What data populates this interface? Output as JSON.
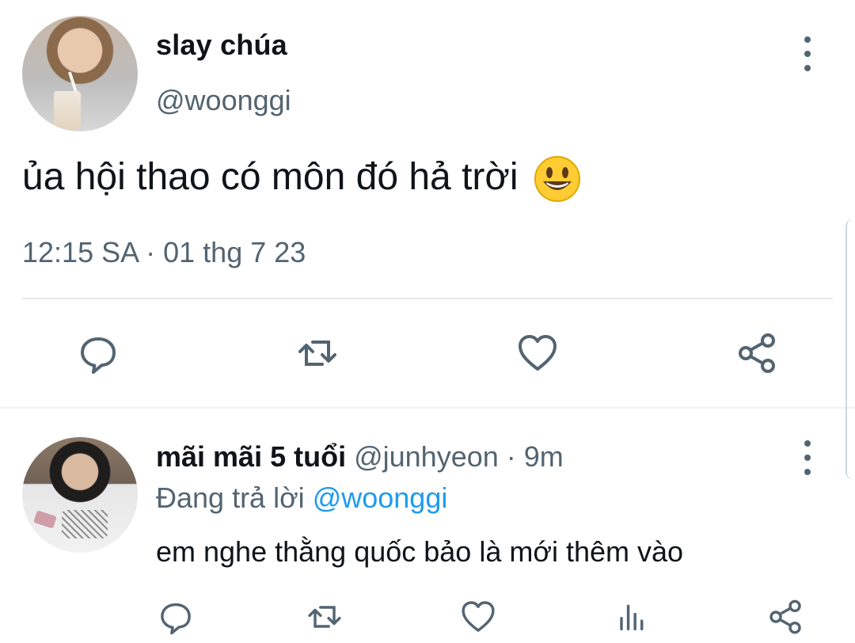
{
  "tweet": {
    "display_name": "slay chúa",
    "handle": "@woonggi",
    "text": "ủa hội thao có môn đó hả trời",
    "emoji": "grinning-face-emoji",
    "timestamp": "12:15 SA · 01 thg 7 23"
  },
  "reply": {
    "display_name": "mãi mãi 5 tuổi",
    "meta": "@junhyeon · 9m",
    "replying_prefix": "Đang trả lời",
    "replying_mention": "@woonggi",
    "text": "em nghe thằng quốc bảo là mới thêm vào"
  },
  "icons": {
    "reply": "comment-icon",
    "retweet": "retweet-icon",
    "like": "heart-icon",
    "share": "share-icon",
    "analytics": "analytics-icon",
    "more": "more-vertical-icon"
  },
  "colors": {
    "text_primary": "#0f1419",
    "text_secondary": "#536471",
    "link": "#1d9bf0",
    "divider": "#e7e9ea"
  }
}
